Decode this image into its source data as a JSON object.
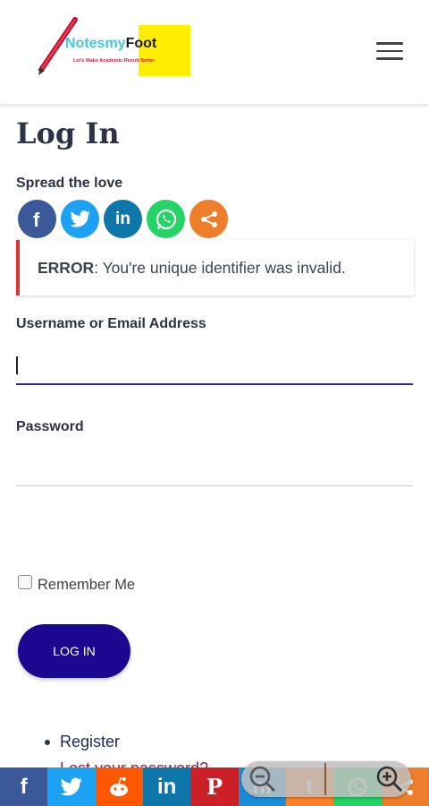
{
  "header": {
    "logo_text_a": "Notesmy",
    "logo_text_b": "Foot",
    "logo_tagline": "Let's Make Academic Result Better",
    "menu_icon": "hamburger-menu-icon"
  },
  "page": {
    "title": "Log In",
    "spread_label": "Spread the love"
  },
  "share_icons": [
    {
      "name": "facebook-icon",
      "glyph": "f",
      "color": "#3b5998"
    },
    {
      "name": "twitter-icon",
      "glyph": "t",
      "color": "#1da1f2"
    },
    {
      "name": "linkedin-icon",
      "glyph": "in",
      "color": "#0e76a8"
    },
    {
      "name": "whatsapp-icon",
      "glyph": "w",
      "color": "#25d366"
    },
    {
      "name": "share-icon",
      "glyph": "<",
      "color": "#ef7e2c"
    }
  ],
  "error": {
    "label": "ERROR",
    "message": ": You're unique identifier was invalid."
  },
  "form": {
    "username_label": "Username or Email Address",
    "username_value": "",
    "password_label": "Password",
    "password_value": "",
    "remember_label": "Remember Me",
    "remember_checked": false,
    "login_button": "LOG IN"
  },
  "links": {
    "register": "Register",
    "lost_password": "Lost your password?"
  },
  "bottom_bar": [
    {
      "name": "facebook-icon",
      "glyph": "f",
      "color": "#3b5998"
    },
    {
      "name": "twitter-icon",
      "glyph": "t",
      "color": "#1da1f2"
    },
    {
      "name": "reddit-icon",
      "glyph": "r",
      "color": "#ff5700"
    },
    {
      "name": "linkedin-icon",
      "glyph": "in",
      "color": "#0e76a8"
    },
    {
      "name": "pinterest-icon",
      "glyph": "P",
      "color": "#cb2027"
    },
    {
      "name": "mix-icon",
      "glyph": "m",
      "color": "#1a8cd8"
    },
    {
      "name": "tumblr-icon",
      "glyph": "t",
      "color": "#ff8226"
    },
    {
      "name": "whatsapp-icon",
      "glyph": "w",
      "color": "#25d366"
    },
    {
      "name": "share-icon",
      "glyph": "<",
      "color": "#ef7e2c"
    }
  ],
  "zoom": {
    "zoom_out_icon": "zoom-out-icon",
    "zoom_in_icon": "zoom-in-icon"
  },
  "colors": {
    "accent": "#1c0890",
    "error_border": "#d63638",
    "focus_line": "#2c2a8c"
  }
}
